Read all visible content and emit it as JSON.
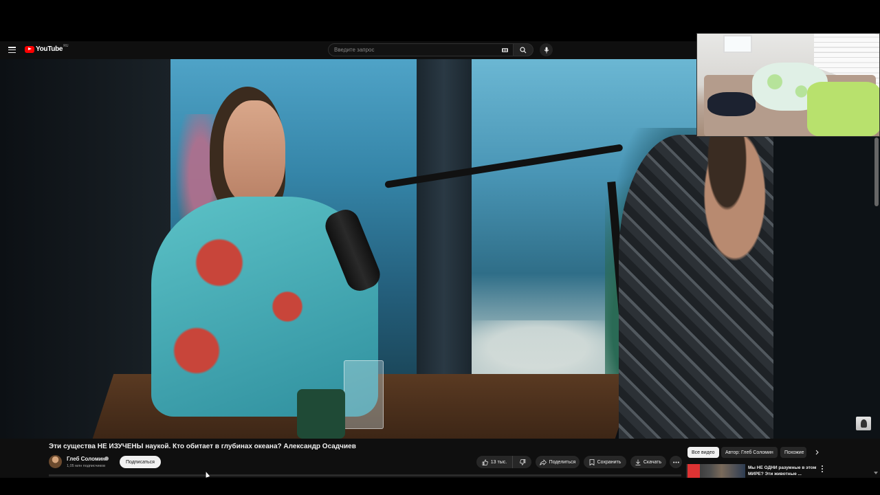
{
  "header": {
    "logo_text": "YouTube",
    "region": "RU",
    "search_placeholder": "Введите запрос"
  },
  "video": {
    "title": "Эти существа НЕ ИЗУЧЕНЫ наукой. Кто обитает в глубинах океана? Александр Осадчиев",
    "channel_name": "Глеб Соломин",
    "subscribers": "1,05 млн подписчиков",
    "subscribe_label": "Подписаться"
  },
  "actions": {
    "likes": "13 тыс.",
    "share_label": "Поделиться",
    "save_label": "Сохранить",
    "download_label": "Скачать"
  },
  "chips": [
    {
      "label": "Все видео",
      "active": true
    },
    {
      "label": "Автор: Глеб Соломин",
      "active": false
    },
    {
      "label": "Похожие",
      "active": false
    }
  ],
  "recommendation": {
    "title": "Мы НЕ ОДНИ разумные в этом МИРЕ? Эти животные ..."
  },
  "icons": {
    "menu": "menu-icon",
    "search": "search-icon",
    "mic": "mic-icon",
    "keyboard": "keyboard-icon",
    "like": "thumbs-up-icon",
    "dislike": "thumbs-down-icon",
    "share": "share-icon",
    "save": "bookmark-icon",
    "download": "download-icon",
    "more": "more-horizontal-icon"
  },
  "colors": {
    "header_bg": "#0f0f0f",
    "logo_red": "#ff0000",
    "pill_bg": "#272727",
    "text": "#f1f1f1"
  }
}
